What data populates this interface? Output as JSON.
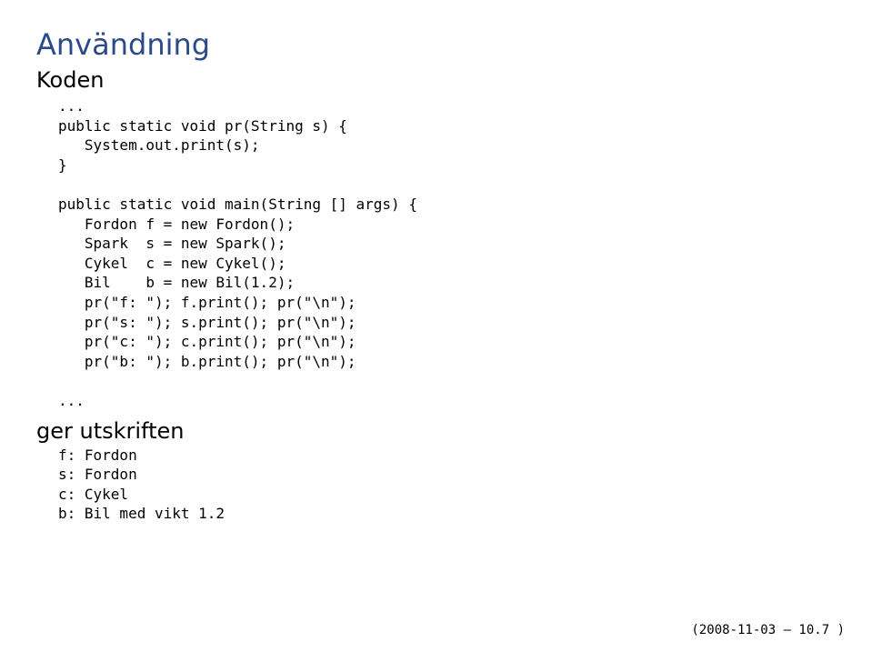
{
  "title": "Användning",
  "subtitle": "Koden",
  "code1": "...\npublic static void pr(String s) {\n   System.out.print(s);\n}\n\npublic static void main(String [] args) {\n   Fordon f = new Fordon();\n   Spark  s = new Spark();\n   Cykel  c = new Cykel();\n   Bil    b = new Bil(1.2);\n   pr(\"f: \"); f.print(); pr(\"\\n\");\n   pr(\"s: \"); s.print(); pr(\"\\n\");\n   pr(\"c: \"); c.print(); pr(\"\\n\");\n   pr(\"b: \"); b.print(); pr(\"\\n\");\n\n...",
  "midtext": "ger utskriften",
  "code2": "f: Fordon\ns: Fordon\nc: Cykel\nb: Bil med vikt 1.2",
  "footer": "(2008-11-03 – 10.7 )"
}
